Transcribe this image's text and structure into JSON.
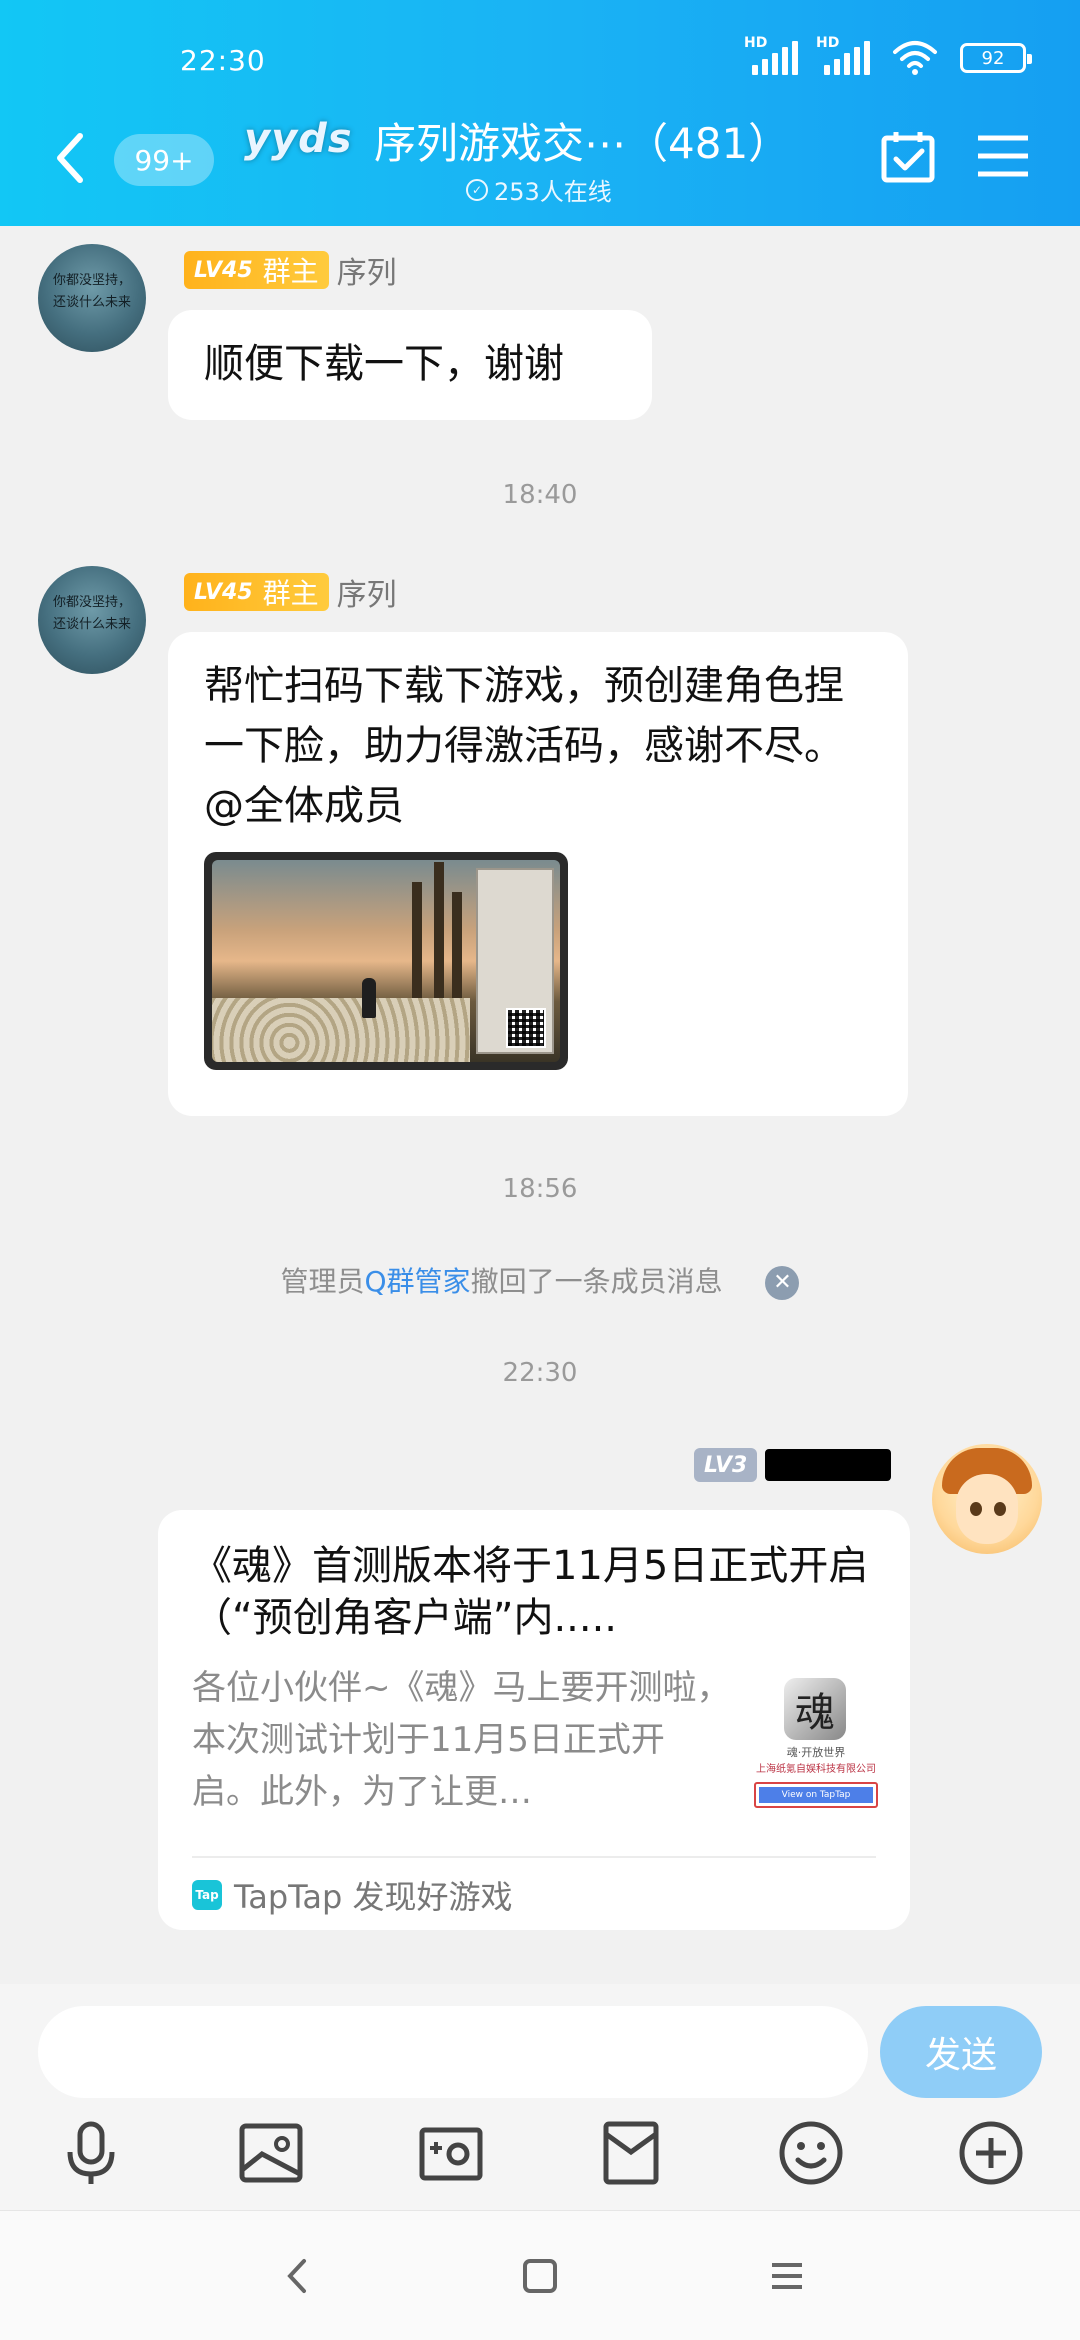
{
  "status_bar": {
    "time": "22:30",
    "battery": "92",
    "network_label": "HD"
  },
  "header": {
    "unread_count": "99+",
    "group_logo": "yyds",
    "group_title": "序列游戏交⋯（481）",
    "online_text": "253人在线"
  },
  "messages": [
    {
      "level": "LV45",
      "role": "群主",
      "sender": "序列",
      "text": "顺便下载一下，谢谢",
      "avatar_text_1": "你都没坚持，",
      "avatar_text_2": "还谈什么未来"
    },
    {
      "level": "LV45",
      "role": "群主",
      "sender": "序列",
      "text": "帮忙扫码下载下游戏，预创建角色捏一下脸，助力得激活码，感谢不尽。@全体成员",
      "avatar_text_1": "你都没坚持，",
      "avatar_text_2": "还谈什么未来"
    }
  ],
  "timestamps": {
    "t1": "18:40",
    "t2": "18:56",
    "t3": "22:30"
  },
  "system_message": {
    "prefix": "管理员",
    "admin": "Q群管家",
    "suffix": "撤回了一条成员消息"
  },
  "my_message": {
    "level": "LV3",
    "card": {
      "title": "《魂》首测版本将于11月5日正式开启（“预创角客户端”内.....",
      "description": "各位小伙伴~《魂》马上要开测啦，本次测试计划于11月5日正式开启。此外，为了让更…",
      "thumb_title": "魂·开放世界",
      "thumb_company": "上海纸氪自娱科技有限公司",
      "thumb_cta": "View on TapTap",
      "thumb_glyph": "魂",
      "source_icon": "Tap",
      "source": "TapTap 发现好游戏"
    }
  },
  "input": {
    "placeholder": "",
    "send_label": "发送"
  },
  "colors": {
    "header_start": "#12c7f5",
    "header_end": "#159ff2",
    "badge": "#ffb21b",
    "link": "#3a8ee8",
    "send": "#8fcdf7"
  }
}
